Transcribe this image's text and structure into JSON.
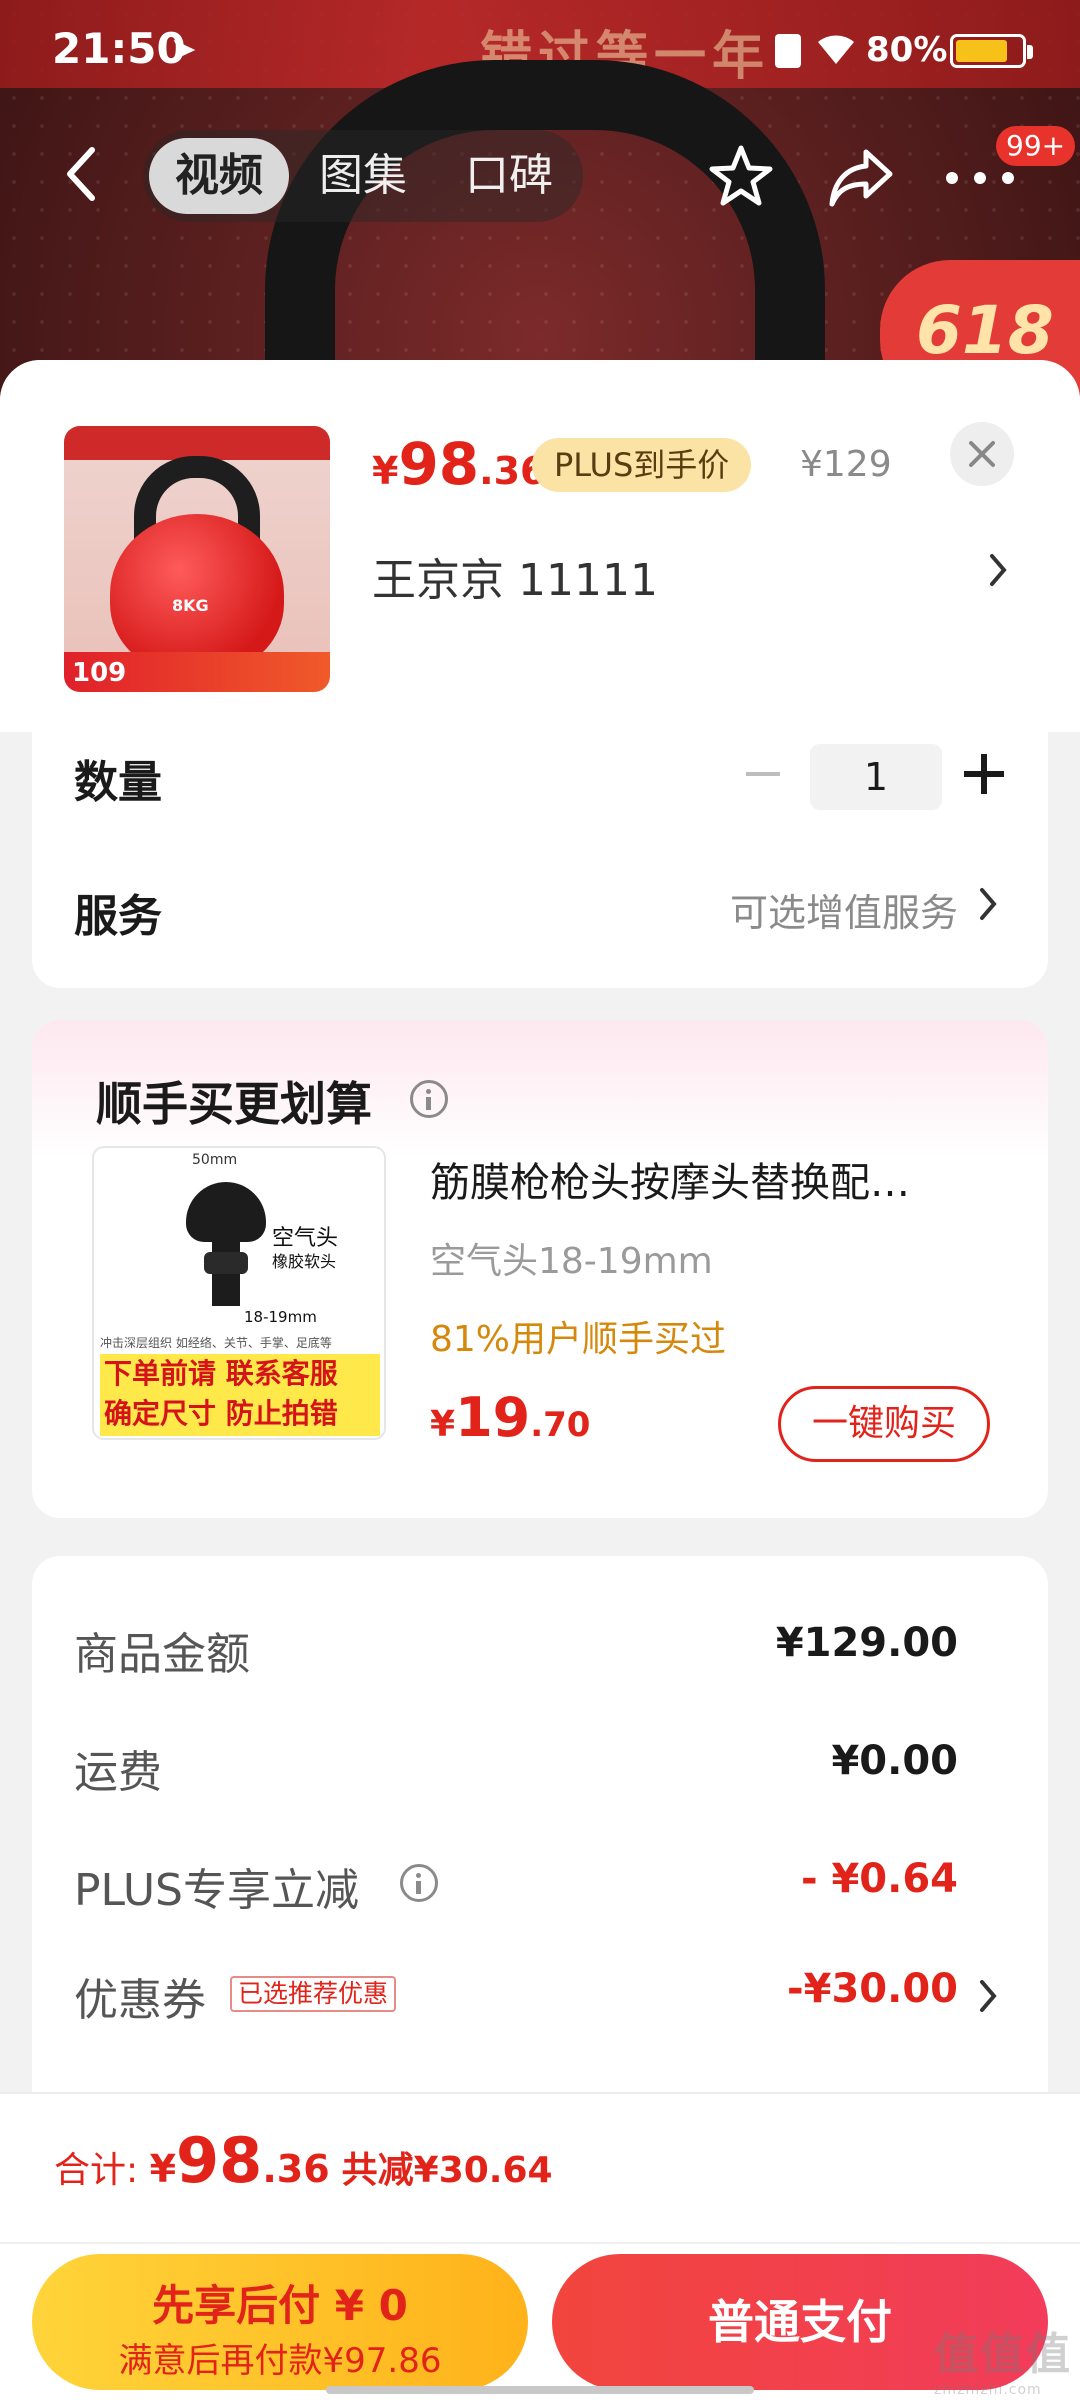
{
  "status_bar": {
    "time": "21:50",
    "battery": "80%",
    "battery_level": 0.8
  },
  "background": {
    "banner_text": "错过等一年",
    "badge_618": "618"
  },
  "nav": {
    "tabs": [
      {
        "label": "视频",
        "active": true
      },
      {
        "label": "图集"
      },
      {
        "label": "口碑"
      }
    ],
    "more_badge": "99+"
  },
  "product": {
    "price_currency": "¥",
    "price_int": "98",
    "price_dec": ".36",
    "plus_tag": "PLUS到手价",
    "original_price": "¥129",
    "seller": "王京京  11111",
    "thumb_label": "8KG",
    "thumb_price": "109"
  },
  "options": {
    "quantity_label": "数量",
    "quantity_value": "1",
    "service_label": "服务",
    "service_value": "可选增值服务"
  },
  "addon": {
    "section_title": "顺手买更划算",
    "name": "筋膜枪枪头按摩头替换配…",
    "spec": "空气头18-19mm",
    "percent_text": "81%用户顺手买过",
    "price_currency": "¥",
    "price_int": "19",
    "price_dec": ".70",
    "buy_button": "一键购买",
    "image_text": {
      "dim_width": "50mm",
      "head_name": "空气头",
      "head_sub": "橡胶软头",
      "dim_thread": "18-19mm",
      "fine_print": "冲击深层组织 如经络、关节、手掌、足底等",
      "warn_line1": "下单前请 联系客服",
      "warn_line2": "确定尺寸 防止拍错"
    }
  },
  "summary": {
    "rows": [
      {
        "label": "商品金额",
        "value": "¥129.00"
      },
      {
        "label": "运费",
        "value": "¥0.00"
      },
      {
        "label": "PLUS专享立减",
        "value": "- ¥0.64"
      },
      {
        "label": "优惠券",
        "value": "-¥30.00",
        "tag": "已选推荐优惠"
      }
    ]
  },
  "footer": {
    "total_label": "合计: ",
    "total_currency": "¥",
    "total_int": "98",
    "total_dec": ".36",
    "total_saved": "共减¥30.64",
    "pay_later_line1": "先享后付 ¥ 0",
    "pay_later_line2": "满意后再付款¥97.86",
    "pay_now": "普通支付"
  },
  "watermark": {
    "main": "值值值",
    "sub": "zhizhizhi.com"
  },
  "colors": {
    "accent_red": "#e2231a",
    "plus_gold": "#fbe3a6",
    "pay_later_yellow": "#ffc42a"
  }
}
